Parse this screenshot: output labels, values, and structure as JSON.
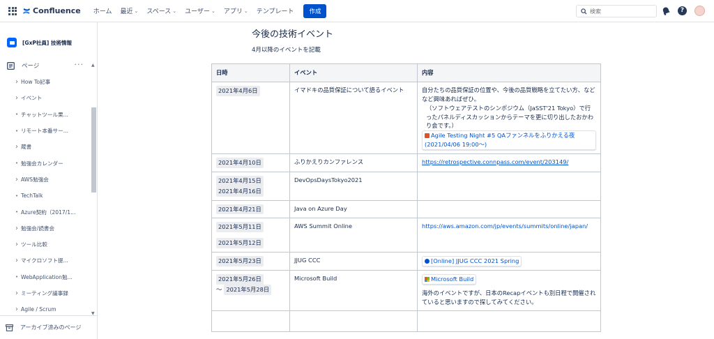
{
  "topbar": {
    "product": "Confluence",
    "nav": [
      {
        "label": "ホーム",
        "dropdown": false
      },
      {
        "label": "最近",
        "dropdown": true
      },
      {
        "label": "スペース",
        "dropdown": true
      },
      {
        "label": "ユーザー",
        "dropdown": true
      },
      {
        "label": "アプリ",
        "dropdown": true
      },
      {
        "label": "テンプレート",
        "dropdown": false
      }
    ],
    "create_label": "作成",
    "search_placeholder": "検索",
    "help_label": "?"
  },
  "sidebar": {
    "space_name": "[GxP社員] 技術情報",
    "pages_label": "ページ",
    "tree": [
      {
        "label": "How To記事",
        "expandable": true
      },
      {
        "label": "イベント",
        "expandable": true
      },
      {
        "label": "チャットツール栗...",
        "expandable": false
      },
      {
        "label": "リモート本番サー...",
        "expandable": false
      },
      {
        "label": "蔵書",
        "expandable": true
      },
      {
        "label": "勉強会カレンダー",
        "expandable": false
      },
      {
        "label": "AWS勉強会",
        "expandable": true
      },
      {
        "label": "TechTalk",
        "expandable": false
      },
      {
        "label": "Azure契約（2017/1...",
        "expandable": false
      },
      {
        "label": "勉強会/読書会",
        "expandable": true
      },
      {
        "label": "ツール比較",
        "expandable": true
      },
      {
        "label": "マイクロソフト提...",
        "expandable": true
      },
      {
        "label": "WebApplication勉...",
        "expandable": false
      },
      {
        "label": "ミーティング議事録",
        "expandable": true
      },
      {
        "label": "Agile / Scrum",
        "expandable": true
      }
    ],
    "archive_label": "アーカイブ済みのページ"
  },
  "main": {
    "title": "今後の技術イベント",
    "subtitle": "4月以降のイベントを記載",
    "table": {
      "headers": [
        "日時",
        "イベント",
        "内容"
      ],
      "rows": [
        {
          "dates": [
            "2021年4月6日"
          ],
          "event": "イマドキの品質保証について語るイベント",
          "content_text": "自分たちの品質保証の位置や、今後の品質戦略を立てたい方、などなど興味あればぜひ。",
          "content_text2": "（ソフトウェアテストのシンポジウム（JaSST'21 Tokyo）で行ったパネルディスカッションからテーマを更に切り出したおかわり会です。）",
          "card": "Agile Testing Night #5 QAファンネルをふりかえる夜 (2021/04/06 19:00〜)"
        },
        {
          "dates": [
            "2021年4月10日"
          ],
          "event": "ふりかえりカンファレンス",
          "link": "https://retrospective.connpass.com/event/203149/"
        },
        {
          "dates": [
            "2021年4月15日",
            "2021年4月16日"
          ],
          "event": "DevOpsDaysTokyo2021"
        },
        {
          "dates": [
            "2021年4月21日"
          ],
          "event": "Java on Azure Day"
        },
        {
          "dates": [
            "2021年5月11日",
            "2021年5月12日"
          ],
          "event": "AWS Summit Online",
          "plain_link": "https://aws.amazon.com/jp/events/summits/online/japan/"
        },
        {
          "dates": [
            "2021年5月23日"
          ],
          "event": "JJUG CCC",
          "card": "[Online] JJUG CCC 2021 Spring"
        },
        {
          "dates": [
            "2021年5月26日",
            "2021年5月28日"
          ],
          "date_separator": "～",
          "event": "Microsoft Build",
          "card": "Microsoft Build",
          "content_text": "海外のイベントですが、日本のRecapイベントも別日程で開催されていると思いますので探してみてください。"
        }
      ]
    }
  },
  "colors": {
    "brand": "#0052cc",
    "sidebar_border": "#dfe1e6",
    "header_bg": "#f4f5f7"
  }
}
